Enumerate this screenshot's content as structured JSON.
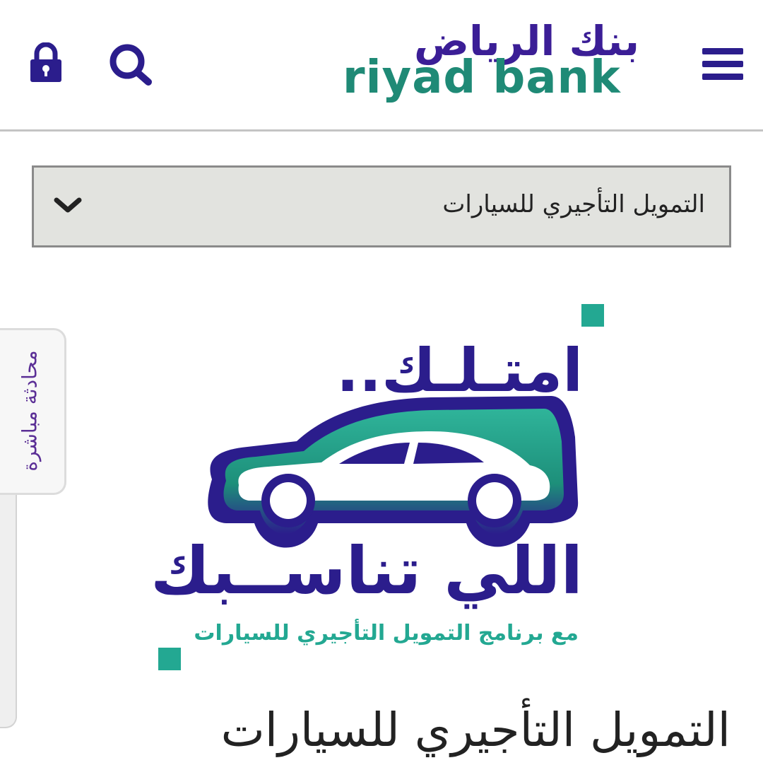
{
  "header": {
    "logo_arabic": "بنك الرياض",
    "logo_english": "riyad bank",
    "brand_colors": {
      "primary": "#2b1d8c",
      "secondary": "#1f8a76"
    }
  },
  "dropdown": {
    "selected_label": "التمويل التأجيري للسيارات"
  },
  "chat_tab": {
    "label": "محادثة مباشرة"
  },
  "promo": {
    "headline": "امتـلـك..",
    "subheadline": "اللي تناســبك",
    "tagline": "مع برنامج التمويل التأجيري للسيارات",
    "accent_color": "#23a892"
  },
  "page": {
    "title": "التمويل التأجيري للسيارات"
  },
  "icons": [
    "menu-icon",
    "search-icon",
    "lock-icon",
    "chevron-down-icon",
    "car-illustration"
  ]
}
